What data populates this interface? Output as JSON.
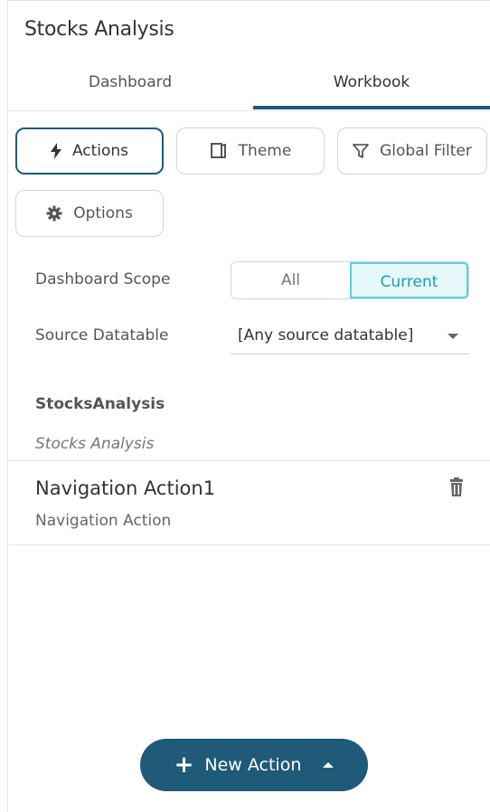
{
  "panel": {
    "title": "Stocks Analysis"
  },
  "tabs": [
    {
      "label": "Dashboard"
    },
    {
      "label": "Workbook"
    }
  ],
  "toolbar": {
    "actions": "Actions",
    "theme": "Theme",
    "global_filter": "Global Filter",
    "options": "Options"
  },
  "scope": {
    "label": "Dashboard Scope",
    "options": [
      "All",
      "Current"
    ],
    "selected": "Current"
  },
  "source": {
    "label": "Source Datatable",
    "value": "[Any source datatable]"
  },
  "group": {
    "name": "StocksAnalysis",
    "subtitle": "Stocks Analysis"
  },
  "actions_list": [
    {
      "title": "Navigation Action1",
      "type": "Navigation Action"
    }
  ],
  "new_action": {
    "label": "New Action"
  },
  "colors": {
    "accent": "#1f5a78",
    "selected_segment": "#1b9bb3"
  }
}
